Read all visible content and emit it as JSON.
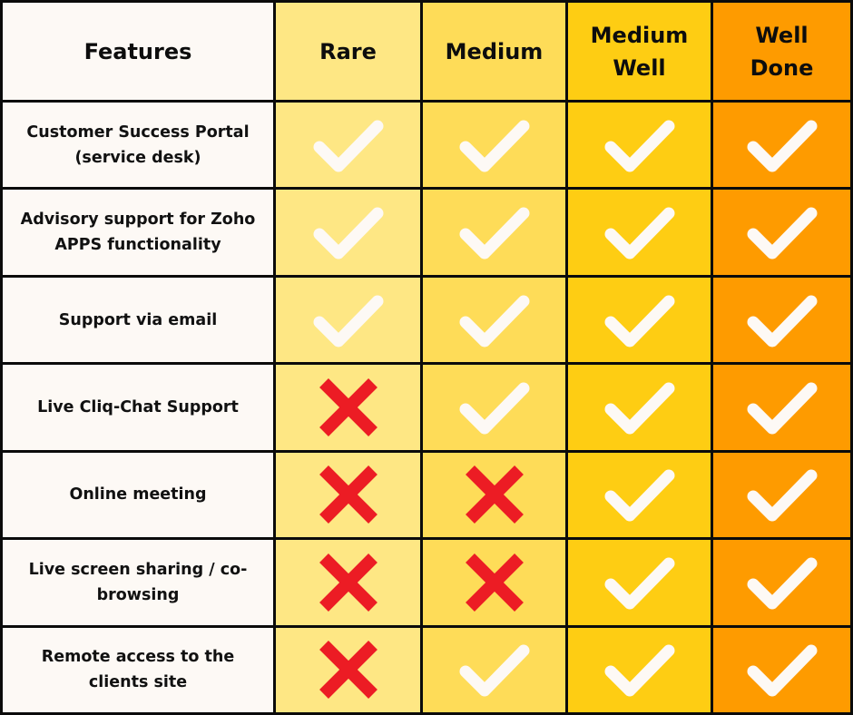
{
  "colors": {
    "feature_bg": "#fdf9f5",
    "rare": "#fee784",
    "medium": "#fedc58",
    "medium_well": "#fecd13",
    "well_done": "#fe9b00",
    "check": "#fdf9f5",
    "cross": "#ec1c24"
  },
  "header": {
    "features": "Features",
    "levels": [
      "Rare",
      "Medium",
      "Medium Well",
      "Well Done"
    ]
  },
  "rows": [
    {
      "feature": "Customer Success Portal (service desk)",
      "values": [
        "check",
        "check",
        "check",
        "check"
      ]
    },
    {
      "feature": "Advisory support for Zoho APPS functionality",
      "values": [
        "check",
        "check",
        "check",
        "check"
      ]
    },
    {
      "feature": "Support via email",
      "values": [
        "check",
        "check",
        "check",
        "check"
      ]
    },
    {
      "feature": "Live Cliq-Chat Support",
      "values": [
        "cross",
        "check",
        "check",
        "check"
      ]
    },
    {
      "feature": "Online meeting",
      "values": [
        "cross",
        "cross",
        "check",
        "check"
      ]
    },
    {
      "feature": "Live screen sharing / co-browsing",
      "values": [
        "cross",
        "cross",
        "check",
        "check"
      ]
    },
    {
      "feature": "Remote access to the clients site",
      "values": [
        "cross",
        "check",
        "check",
        "check"
      ]
    }
  ]
}
